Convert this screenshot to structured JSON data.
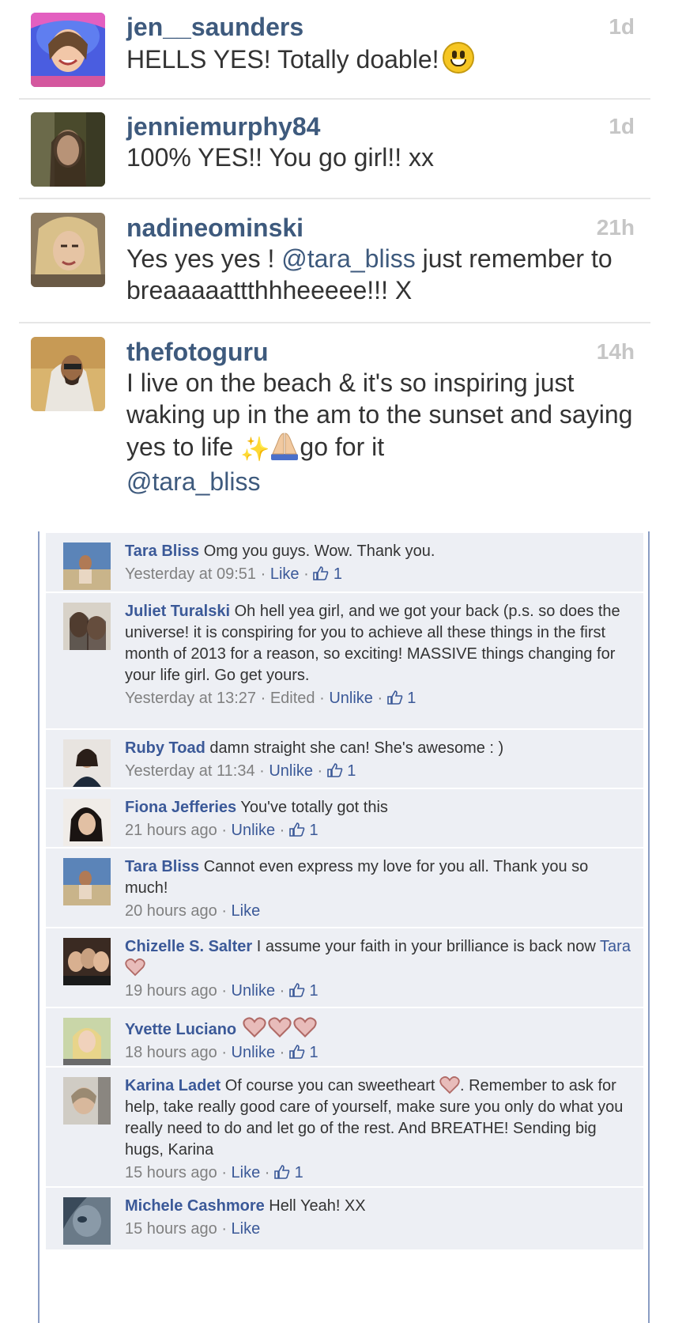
{
  "instagram_comments": [
    {
      "username": "jen__saunders",
      "time": "1d",
      "text": "HELLS YES! Totally doable!",
      "emoji": "smile-emoji"
    },
    {
      "username": "jenniemurphy84",
      "time": "1d",
      "text": "100% YES!! You go girl!! xx"
    },
    {
      "username": "nadineominski",
      "time": "21h",
      "text_before": "Yes yes yes ! ",
      "mention": "@tara_bliss",
      "text_after": " just remember to breaaaaattthhheeeee!!! X"
    },
    {
      "username": "thefotoguru",
      "time": "14h",
      "text": "I live on the beach & it's so inspiring just waking up in the am to the sunset and saying yes to life",
      "text_after": "go for it",
      "mention": "@tara_bliss",
      "emojis": [
        "sparkles-emoji",
        "praying-hands-emoji"
      ]
    }
  ],
  "facebook_comments": [
    {
      "name": "Tara Bliss",
      "text": "Omg you guys. Wow. Thank you.",
      "time": "Yesterday at 09:51",
      "sep": " · ",
      "action": "Like",
      "likes": "1"
    },
    {
      "name": "Juliet Turalski",
      "text": "Oh hell yea girl, and we got your back (p.s. so does the universe! it is conspiring for you to achieve all these things in the first month of 2013 for a reason, so exciting! MASSIVE things changing for your life girl. Go get yours.",
      "time": "Yesterday at 13:27",
      "edited": "Edited",
      "sep": " · ",
      "action": "Unlike",
      "likes": "1"
    },
    {
      "name": "Ruby Toad",
      "text": "damn straight she can! She's awesome : )",
      "time": "Yesterday at 11:34",
      "sep": " · ",
      "action": "Unlike",
      "likes": "1"
    },
    {
      "name": "Fiona Jefferies",
      "text": "You've totally got this",
      "time": "21 hours ago",
      "sep": " · ",
      "action": "Unlike",
      "likes": "1"
    },
    {
      "name": "Tara Bliss",
      "text": "Cannot even express my love for you all. Thank you so much!",
      "time": "20 hours ago",
      "sep": " · ",
      "action": "Like"
    },
    {
      "name": "Chizelle S. Salter",
      "text": "I assume your faith in your brilliance is back now",
      "tag": "Tara",
      "time": "19 hours ago",
      "sep": " · ",
      "action": "Unlike",
      "likes": "1"
    },
    {
      "name": "Yvette Luciano",
      "time": "18 hours ago",
      "sep": " · ",
      "action": "Unlike",
      "likes": "1"
    },
    {
      "name": "Karina Ladet",
      "text": "Of course you can sweetheart",
      "text_after": ". Remember to ask for help, take really good care of yourself, make sure you only do what you really need to do and let go of the rest. And BREATHE! Sending big hugs, Karina",
      "time": "15 hours ago",
      "sep": " · ",
      "action": "Like",
      "likes": "1"
    },
    {
      "name": "Michele Cashmore",
      "text": "Hell Yeah! XX",
      "time": "15 hours ago",
      "sep": " · ",
      "action": "Like"
    }
  ],
  "colors": {
    "ig_username": "#3e5a7d",
    "ig_time": "#c6c6c6",
    "fb_link": "#3b5998",
    "fb_bg": "#edeff4",
    "heart": "#c9827f"
  }
}
